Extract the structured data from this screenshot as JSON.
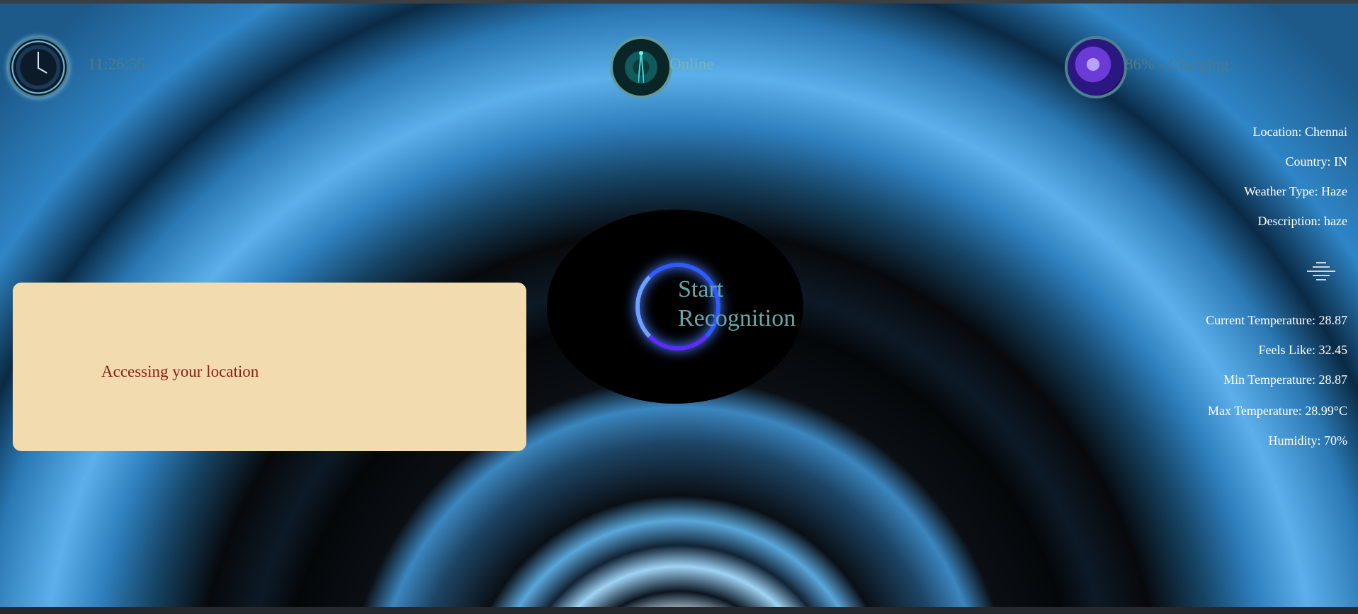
{
  "header": {
    "clock": {
      "time": "11:26:55"
    },
    "network": {
      "status": "Online"
    },
    "battery": {
      "status": "86% - Charging"
    }
  },
  "weather": {
    "location": "Location: Chennai",
    "country": "Country: IN",
    "type": "Weather Type: Haze",
    "description": "Description: haze",
    "current_temp": "Current Temperature: 28.87",
    "feels_like": "Feels Like: 32.45",
    "min_temp": "Min Temperature: 28.87",
    "max_temp": "Max Temperature: 28.99°C",
    "humidity": "Humidity: 70%"
  },
  "location_panel": {
    "message": "Accessing your location"
  },
  "assistant": {
    "start_label_line1": "Start",
    "start_label_line2": "Recognition"
  },
  "colors": {
    "accent": "#79b3b5",
    "panel_bg": "#f3dbb0",
    "panel_text": "#8b1c12"
  },
  "icons": [
    "clock-icon",
    "antenna-icon",
    "battery-icon",
    "menu-icon"
  ]
}
